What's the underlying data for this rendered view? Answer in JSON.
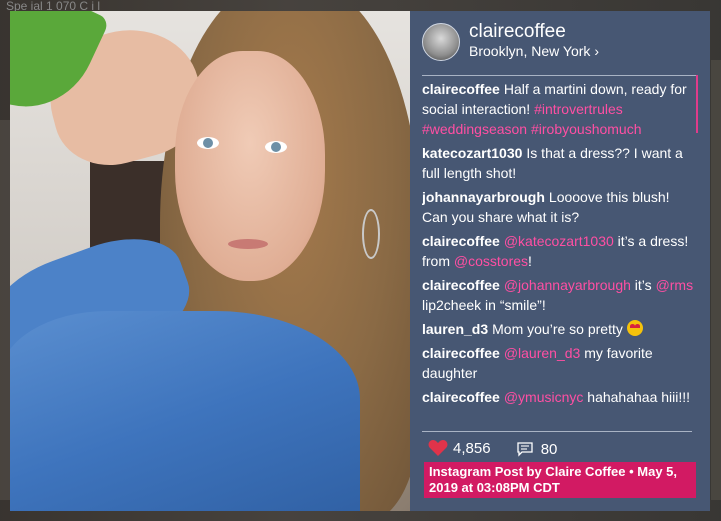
{
  "background": {
    "header_text": "Spe ial      1 070 C   i l"
  },
  "post": {
    "username": "clairecoffee",
    "location": "Brooklyn, New York",
    "location_chevron": "›",
    "comments": [
      {
        "user": "clairecoffee",
        "parts": [
          {
            "t": "Half a martini down, ready for social interaction! "
          },
          {
            "t": "#introvertrules",
            "tag": true
          },
          {
            "t": " "
          },
          {
            "t": "#weddingseason",
            "tag": true
          },
          {
            "t": " "
          },
          {
            "t": "#irobyoushomuch",
            "tag": true
          }
        ]
      },
      {
        "user": "katecozart1030",
        "parts": [
          {
            "t": "Is that a dress?? I want a full length shot!"
          }
        ]
      },
      {
        "user": "johannayarbrough",
        "parts": [
          {
            "t": "Loooove this blush! Can you share what it is?"
          }
        ]
      },
      {
        "user": "clairecoffee",
        "parts": [
          {
            "t": "@katecozart1030",
            "tag": true
          },
          {
            "t": " it’s a dress! from "
          },
          {
            "t": "@cosstores",
            "tag": true
          },
          {
            "t": "!"
          }
        ]
      },
      {
        "user": "clairecoffee",
        "parts": [
          {
            "t": "@johannayarbrough",
            "tag": true
          },
          {
            "t": " it’s "
          },
          {
            "t": "@rms",
            "tag": true
          },
          {
            "t": " lip2cheek in “smile”!"
          }
        ]
      },
      {
        "user": "lauren_d3",
        "parts": [
          {
            "t": "Mom you’re so pretty "
          },
          {
            "emoji": "star-struck-emoji"
          }
        ]
      },
      {
        "user": "clairecoffee",
        "parts": [
          {
            "t": "@lauren_d3",
            "tag": true
          },
          {
            "t": " my favorite daughter"
          }
        ]
      },
      {
        "user": "clairecoffee",
        "parts": [
          {
            "t": "@ymusicnyc",
            "tag": true
          },
          {
            "t": " hahahahaa hiii!!!"
          }
        ]
      }
    ],
    "likes": "4,856",
    "comment_count": "80",
    "caption": "Instagram Post by Claire Coffee • May 5, 2019 at 03:08PM CDT"
  },
  "colors": {
    "panel_bg": "#475773",
    "tag": "#ff4fa3",
    "caption_bg": "#d21a63",
    "heart": "#e0334a"
  },
  "icons": [
    "chevron-right-icon",
    "heart-icon",
    "comment-icon",
    "star-struck-emoji"
  ]
}
